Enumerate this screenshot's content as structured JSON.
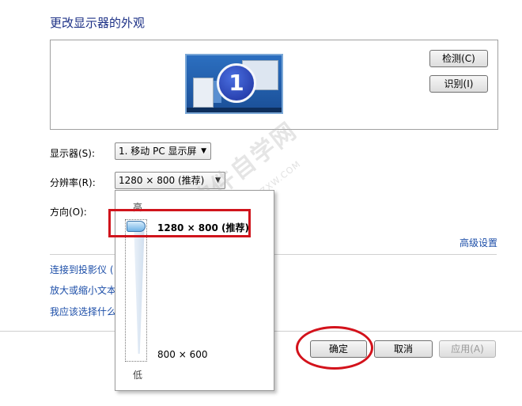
{
  "header": {
    "title": "更改显示器的外观"
  },
  "preview": {
    "monitor_number": "1",
    "detect_button": "检测(C)",
    "identify_button": "识别(I)"
  },
  "settings": {
    "display_label": "显示器(S):",
    "display_value": "1. 移动 PC 显示屏",
    "resolution_label": "分辨率(R):",
    "resolution_value": "1280 × 800 (推荐)",
    "orientation_label": "方向(O):",
    "advanced_link": "高级设置"
  },
  "links": [
    {
      "label": "连接到投影仪 ("
    },
    {
      "label": "放大或缩小文本"
    },
    {
      "label": "我应该选择什么"
    }
  ],
  "resolution_popup": {
    "high_label": "高",
    "low_label": "低",
    "max_resolution": "1280 × 800 (推荐)",
    "min_resolution": "800 × 600",
    "slider_position_fraction": 1.0
  },
  "footer": {
    "ok_button": "确定",
    "cancel_button": "取消",
    "apply_button": "应用(A)"
  },
  "watermark": {
    "text": "软件自学网",
    "url": "WWW.RJZXW.COM"
  },
  "colors": {
    "title": "#1e3287",
    "link": "#1c4ea8",
    "annotation_red": "#d0141c"
  }
}
